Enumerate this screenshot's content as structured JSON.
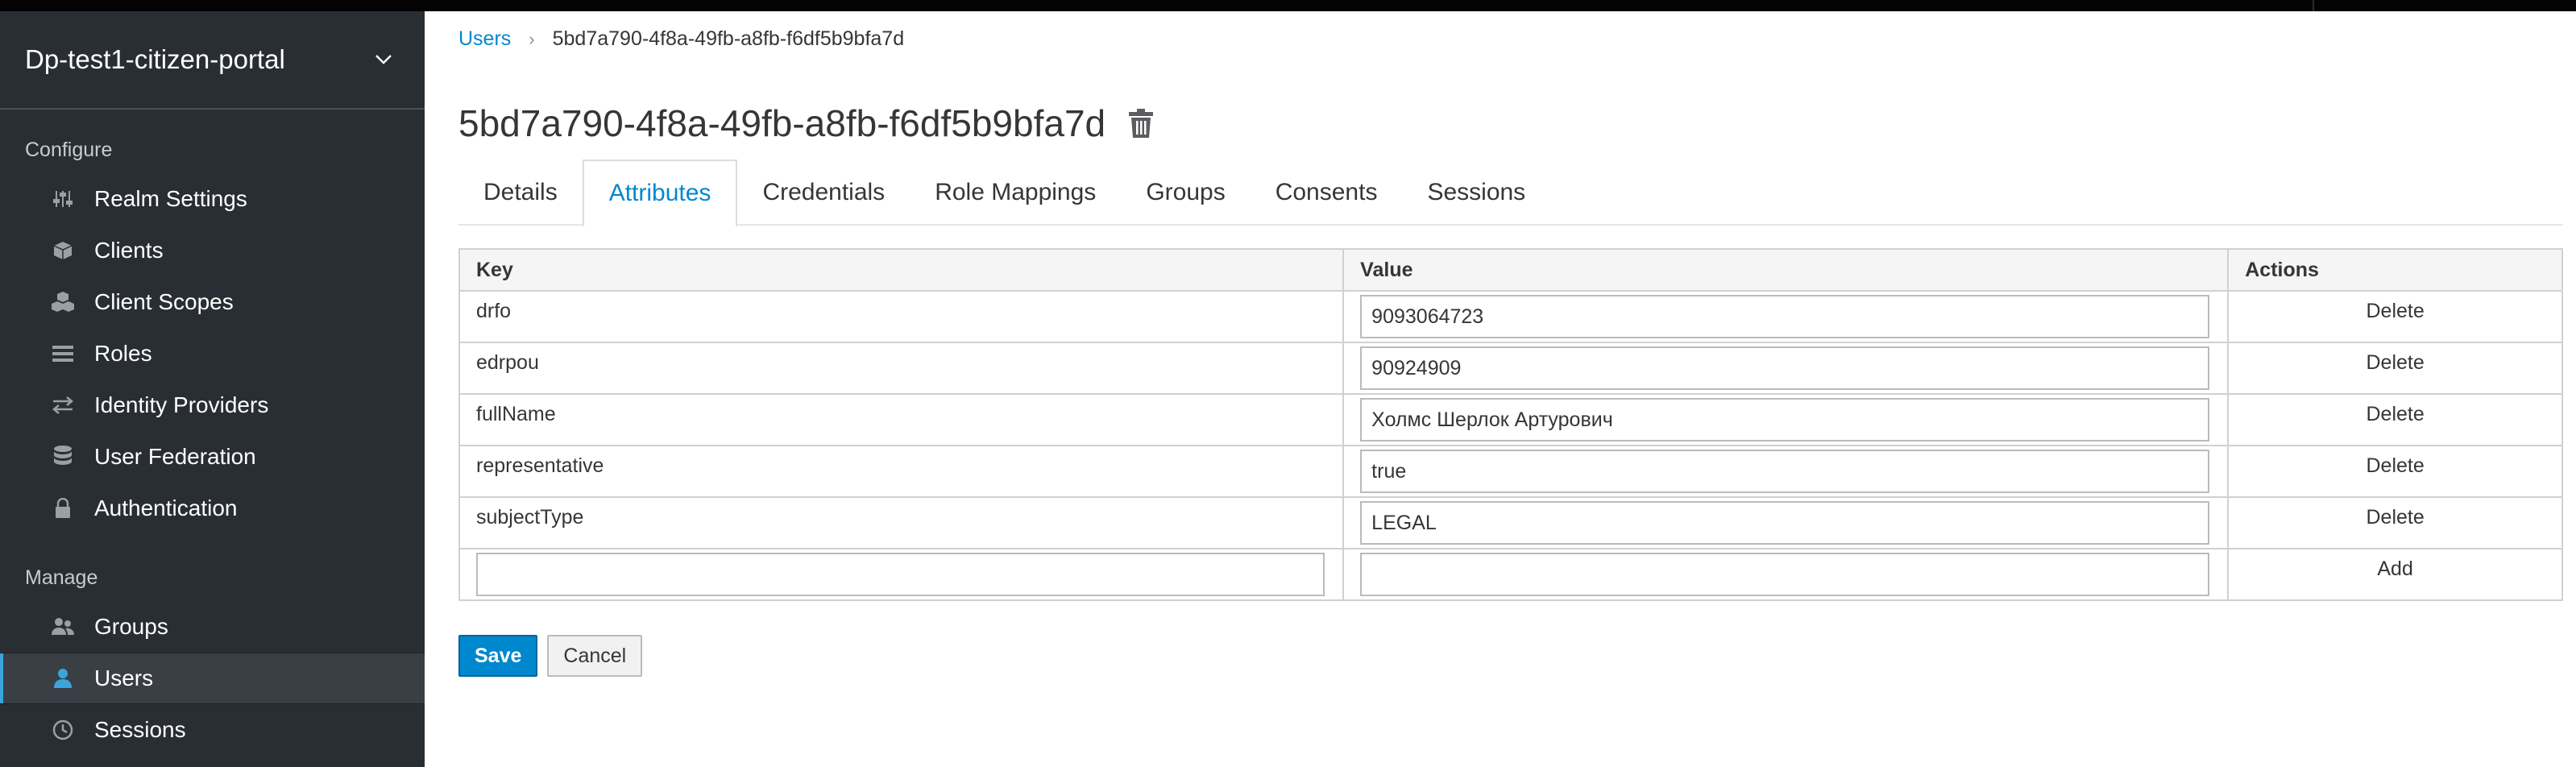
{
  "sidebar": {
    "realm_name": "Dp-test1-citizen-portal",
    "configure_label": "Configure",
    "configure_items": [
      {
        "label": "Realm Settings",
        "icon": "sliders-icon"
      },
      {
        "label": "Clients",
        "icon": "cube-icon"
      },
      {
        "label": "Client Scopes",
        "icon": "cubes-icon"
      },
      {
        "label": "Roles",
        "icon": "list-icon"
      },
      {
        "label": "Identity Providers",
        "icon": "exchange-icon"
      },
      {
        "label": "User Federation",
        "icon": "database-icon"
      },
      {
        "label": "Authentication",
        "icon": "lock-icon"
      }
    ],
    "manage_label": "Manage",
    "manage_items": [
      {
        "label": "Groups",
        "icon": "users-icon"
      },
      {
        "label": "Users",
        "icon": "user-icon",
        "active": true
      },
      {
        "label": "Sessions",
        "icon": "clock-icon"
      }
    ]
  },
  "breadcrumb": {
    "parent": "Users",
    "current": "5bd7a790-4f8a-49fb-a8fb-f6df5b9bfa7d"
  },
  "page": {
    "title": "5bd7a790-4f8a-49fb-a8fb-f6df5b9bfa7d"
  },
  "tabs": [
    {
      "label": "Details"
    },
    {
      "label": "Attributes",
      "active": true
    },
    {
      "label": "Credentials"
    },
    {
      "label": "Role Mappings"
    },
    {
      "label": "Groups"
    },
    {
      "label": "Consents"
    },
    {
      "label": "Sessions"
    }
  ],
  "table": {
    "headers": {
      "key": "Key",
      "value": "Value",
      "actions": "Actions"
    },
    "rows": [
      {
        "key": "drfo",
        "value": "9093064723",
        "action": "Delete"
      },
      {
        "key": "edrpou",
        "value": "90924909",
        "action": "Delete"
      },
      {
        "key": "fullName",
        "value": "Холмс Шерлок Артурович",
        "action": "Delete"
      },
      {
        "key": "representative",
        "value": "true",
        "action": "Delete"
      },
      {
        "key": "subjectType",
        "value": "LEGAL",
        "action": "Delete"
      }
    ],
    "new_row": {
      "key": "",
      "value": "",
      "action": "Add"
    }
  },
  "buttons": {
    "save": "Save",
    "cancel": "Cancel"
  },
  "colors": {
    "sidebar_bg": "#292e34",
    "accent": "#0088ce",
    "active_indicator": "#39a5dc"
  }
}
